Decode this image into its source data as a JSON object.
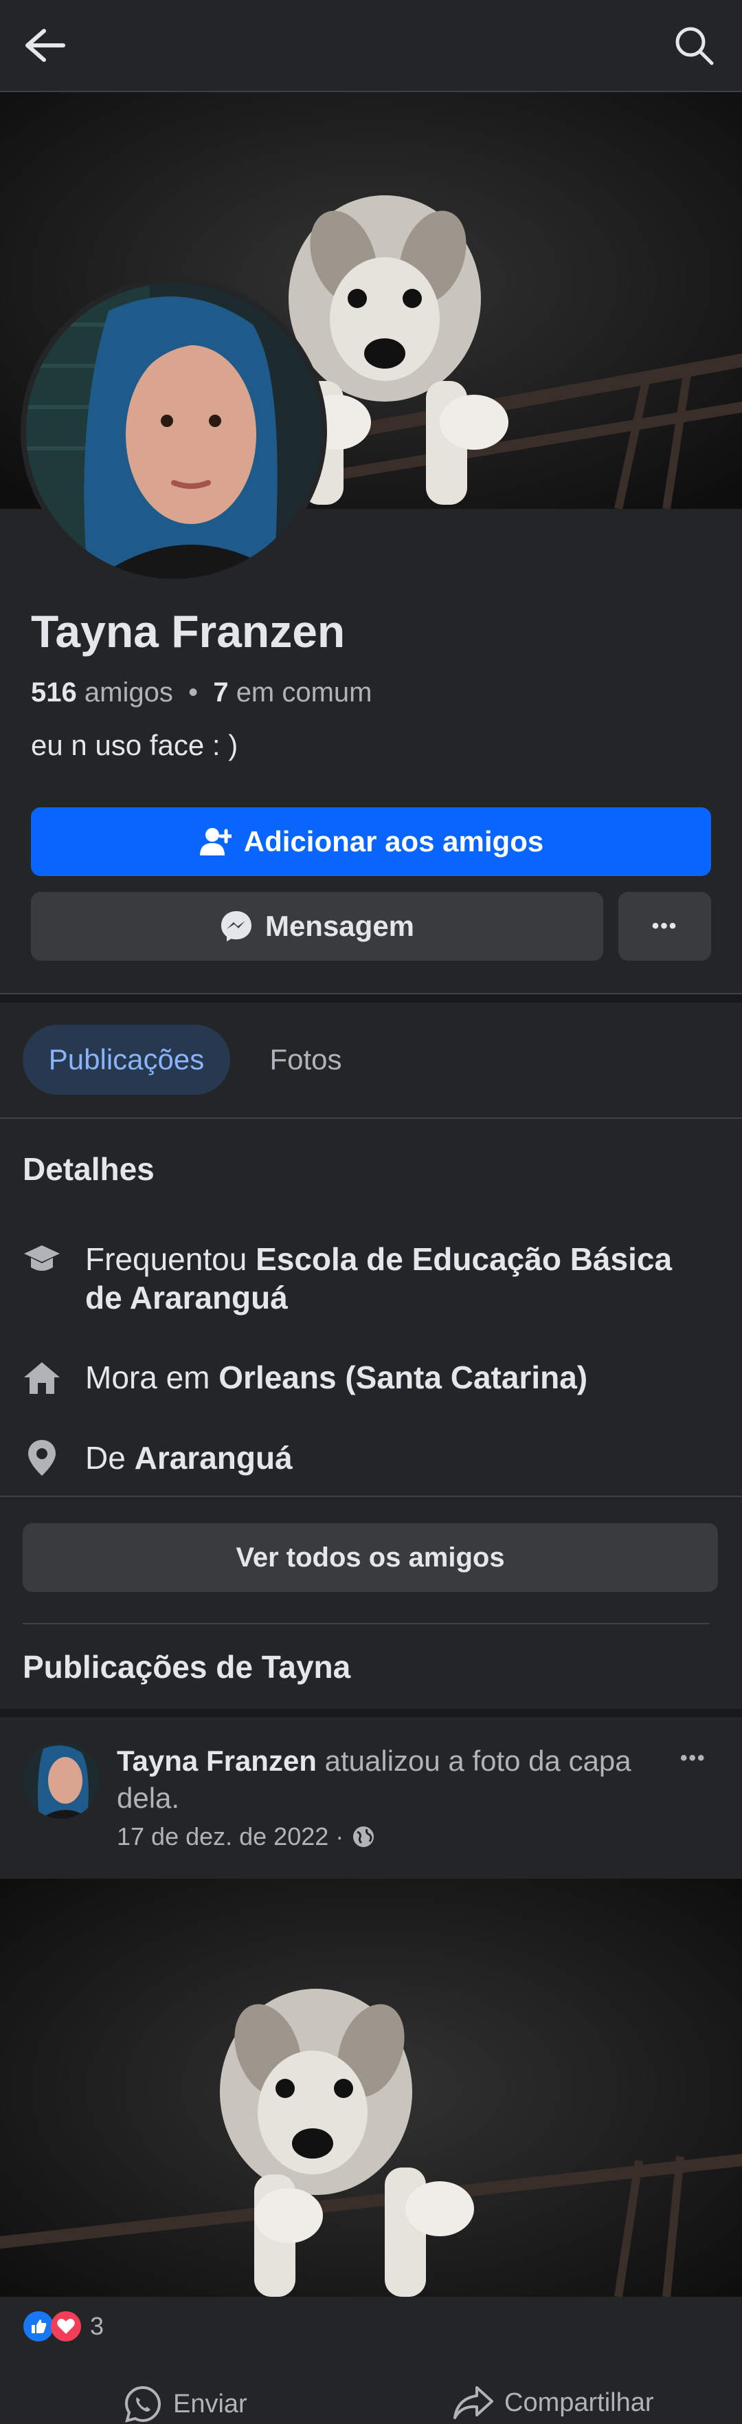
{
  "header": {
    "back_icon": "arrow-left-icon",
    "search_icon": "search-icon"
  },
  "profile": {
    "name": "Tayna Franzen",
    "friends_count": "516",
    "friends_label": "amigos",
    "mutual_count": "7",
    "mutual_label": "em comum",
    "separator": "•",
    "bio": "eu n uso face : )"
  },
  "actions": {
    "add_friend_label": "Adicionar aos amigos",
    "message_label": "Mensagem",
    "more_label": "•••"
  },
  "tabs": [
    {
      "label": "Publicações",
      "active": true
    },
    {
      "label": "Fotos",
      "active": false
    }
  ],
  "details": {
    "title": "Detalhes",
    "items": [
      {
        "icon": "graduation-cap-icon",
        "prefix": "Frequentou ",
        "value": "Escola de Educação Básica de Araranguá"
      },
      {
        "icon": "home-icon",
        "prefix": "Mora em ",
        "value": "Orleans (Santa Catarina)"
      },
      {
        "icon": "location-pin-icon",
        "prefix": "De ",
        "value": "Araranguá"
      }
    ]
  },
  "friends": {
    "see_all_label": "Ver todos os amigos"
  },
  "posts": {
    "title": "Publicações de Tayna",
    "post": {
      "author": "Tayna Franzen",
      "action_text": " atualizou a foto da capa dela.",
      "date": "17 de dez. de 2022 ·",
      "privacy_icon": "globe-icon",
      "reaction_count": "3",
      "send_label": "Enviar",
      "share_label": "Compartilhar"
    }
  },
  "colors": {
    "background": "#242526",
    "primary": "#0866ff",
    "secondary_button": "#3a3b3c",
    "active_tab_bg": "#263951",
    "active_tab_text": "#8ab4f8"
  }
}
